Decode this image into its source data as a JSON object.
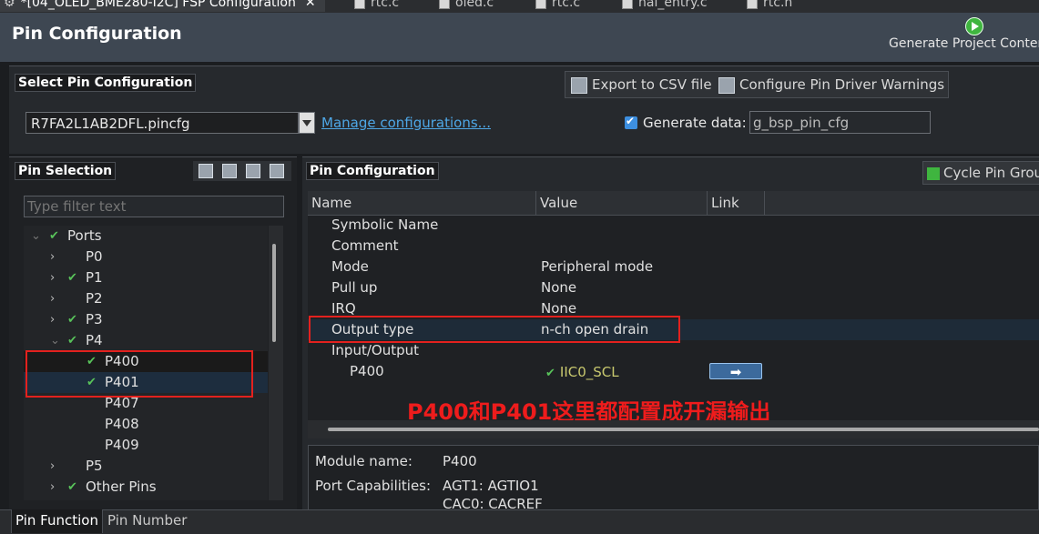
{
  "editor_tabs": [
    {
      "label": "*[04_OLED_BME280-I2C] FSP Configuration",
      "active": true
    },
    {
      "label": "rtc.c"
    },
    {
      "label": "oled.c"
    },
    {
      "label": "rtc.c"
    },
    {
      "label": "hal_entry.c"
    },
    {
      "label": "rtc.h"
    }
  ],
  "header": {
    "title": "Pin Configuration",
    "generate_label": "Generate Project Content",
    "generate_icon": "play-icon"
  },
  "select_config": {
    "title": "Select Pin Configuration",
    "export_label": "Export to CSV file",
    "warnings_label": "Configure Pin Driver Warnings",
    "selected_file": "R7FA2L1AB2DFL.pincfg",
    "manage_link": "Manage configurations...",
    "generate_data_label": "Generate data:",
    "generate_data_checked": true,
    "generate_data_value": "g_bsp_pin_cfg"
  },
  "pin_selection": {
    "title": "Pin Selection",
    "filter_placeholder": "Type filter text",
    "tree": [
      {
        "label": "Ports",
        "level": 0,
        "expanded": true,
        "checked": true
      },
      {
        "label": "P0",
        "level": 1,
        "expandable": true,
        "checked": false
      },
      {
        "label": "P1",
        "level": 1,
        "expandable": true,
        "checked": true
      },
      {
        "label": "P2",
        "level": 1,
        "expandable": true,
        "checked": false
      },
      {
        "label": "P3",
        "level": 1,
        "expandable": true,
        "checked": true
      },
      {
        "label": "P4",
        "level": 1,
        "expanded": true,
        "checked": true
      },
      {
        "label": "P400",
        "level": 2,
        "checked": true,
        "selected": true
      },
      {
        "label": "P401",
        "level": 2,
        "checked": true,
        "selected": true
      },
      {
        "label": "P407",
        "level": 2,
        "checked": false
      },
      {
        "label": "P408",
        "level": 2,
        "checked": false
      },
      {
        "label": "P409",
        "level": 2,
        "checked": false
      },
      {
        "label": "P5",
        "level": 1,
        "expandable": true,
        "checked": false
      },
      {
        "label": "Other Pins",
        "level": 1,
        "expandable": true,
        "checked": true
      }
    ]
  },
  "pin_config": {
    "title": "Pin Configuration",
    "cycle_label": "Cycle Pin Group",
    "columns": [
      "Name",
      "Value",
      "Link"
    ],
    "rows": [
      {
        "name": "Symbolic Name",
        "value": ""
      },
      {
        "name": "Comment",
        "value": ""
      },
      {
        "name": "Mode",
        "value": "Peripheral mode"
      },
      {
        "name": "Pull up",
        "value": "None"
      },
      {
        "name": "IRQ",
        "value": "None"
      },
      {
        "name": "Output type",
        "value": "n-ch open drain"
      },
      {
        "name": "Input/Output",
        "value": ""
      },
      {
        "name": "P400",
        "value": "IIC0_SCL"
      }
    ],
    "link_button": "➡",
    "annotation": "P400和P401这里都配置成开漏输出"
  },
  "details": {
    "module_label": "Module name:",
    "module_value": "P400",
    "caps_label": "Port Capabilities:",
    "caps": [
      "AGT1: AGTIO1",
      "CAC0: CACREF"
    ]
  },
  "bottom_tabs": [
    "Pin Function",
    "Pin Number"
  ]
}
